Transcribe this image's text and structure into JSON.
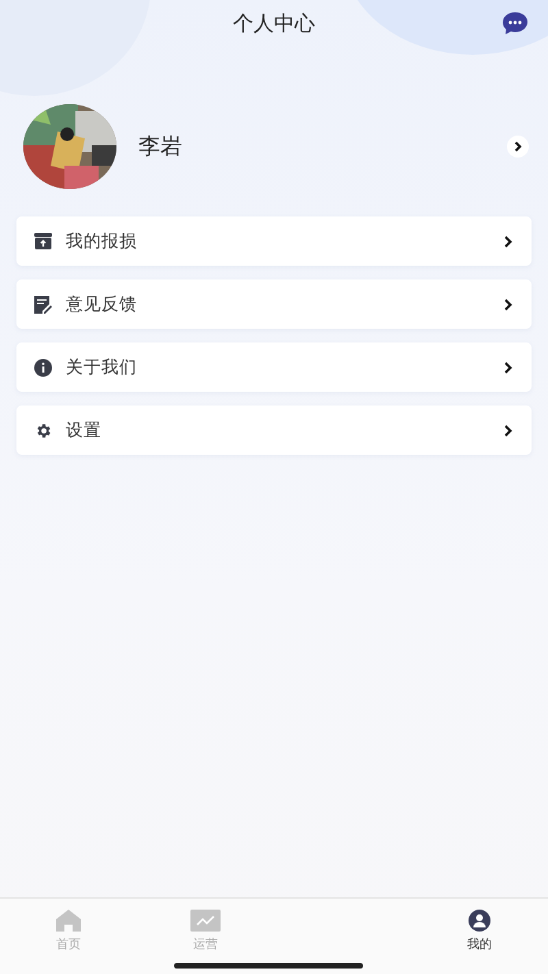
{
  "header": {
    "title": "个人中心"
  },
  "profile": {
    "name": "李岩"
  },
  "menu": [
    {
      "kind": "archive",
      "label": "我的报损"
    },
    {
      "kind": "edit",
      "label": "意见反馈"
    },
    {
      "kind": "info",
      "label": "关于我们"
    },
    {
      "kind": "settings",
      "label": "设置"
    }
  ],
  "tab_bar": [
    {
      "kind": "home",
      "label": "首页",
      "selected": false
    },
    {
      "kind": "chart",
      "label": "运营",
      "selected": false
    },
    {
      "kind": "user",
      "label": "我的",
      "selected": true
    }
  ]
}
